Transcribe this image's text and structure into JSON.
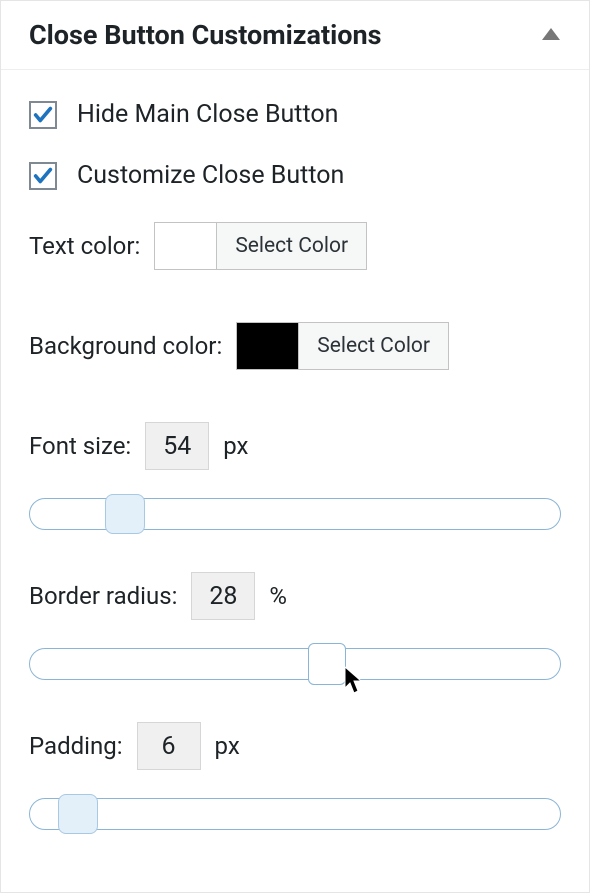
{
  "panel": {
    "title": "Close Button Customizations"
  },
  "checkboxes": {
    "hide_main": {
      "label": "Hide Main Close Button",
      "checked": true
    },
    "customize": {
      "label": "Customize Close Button",
      "checked": true
    }
  },
  "text_color": {
    "label": "Text color:",
    "button": "Select Color",
    "value": "#ffffff"
  },
  "background_color": {
    "label": "Background color:",
    "button": "Select Color",
    "value": "#000000"
  },
  "font_size": {
    "label": "Font size:",
    "value": "54",
    "unit": "px",
    "slider_pct": 18
  },
  "border_radius": {
    "label": "Border radius:",
    "value": "28",
    "unit": "%",
    "slider_pct": 56
  },
  "padding": {
    "label": "Padding:",
    "value": "6",
    "unit": "px",
    "slider_pct": 9
  }
}
